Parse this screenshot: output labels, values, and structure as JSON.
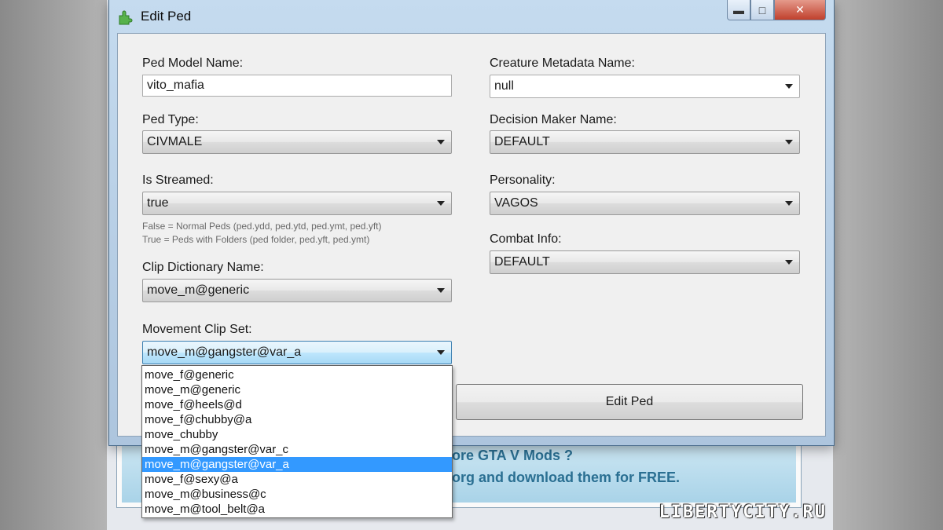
{
  "window": {
    "title": "Edit Ped",
    "buttons": {
      "minimize": "▬",
      "maximize": "□",
      "close": "✕"
    }
  },
  "form": {
    "ped_model_name": {
      "label": "Ped Model Name:",
      "value": "vito_mafia"
    },
    "ped_type": {
      "label": "Ped Type:",
      "value": "CIVMALE"
    },
    "is_streamed": {
      "label": "Is Streamed:",
      "value": "true",
      "hint_false": "False = Normal Peds (ped.ydd, ped.ytd, ped.ymt, ped.yft)",
      "hint_true": "True = Peds with Folders (ped folder, ped.yft, ped.ymt)"
    },
    "clip_dictionary_name": {
      "label": "Clip Dictionary Name:",
      "value": "move_m@generic"
    },
    "movement_clip_set": {
      "label": "Movement Clip Set:",
      "value": "move_m@gangster@var_a",
      "options": [
        "move_f@generic",
        "move_m@generic",
        "move_f@heels@d",
        "move_f@chubby@a",
        "move_chubby",
        "move_m@gangster@var_c",
        "move_m@gangster@var_a",
        "move_f@sexy@a",
        "move_m@business@c",
        "move_m@tool_belt@a"
      ],
      "selected_index": 6
    },
    "creature_metadata_name": {
      "label": "Creature Metadata Name:",
      "value": "null"
    },
    "decision_maker_name": {
      "label": "Decision Maker Name:",
      "value": "DEFAULT"
    },
    "personality": {
      "label": "Personality:",
      "value": "VAGOS"
    },
    "combat_info": {
      "label": "Combat Info:",
      "value": "DEFAULT"
    },
    "submit_label": "Edit Ped"
  },
  "background": {
    "banner_line1": "ore GTA V Mods ?",
    "banner_line2": "org and download them for FREE.",
    "watermark": "LIBERTYCITY.RU"
  },
  "colors": {
    "titlebar": "#c5dbef",
    "close_button": "#c0402c",
    "selection": "#3399ff",
    "client_bg": "#f0f0f0"
  },
  "icons": {
    "app": "green-plugin-icon"
  }
}
